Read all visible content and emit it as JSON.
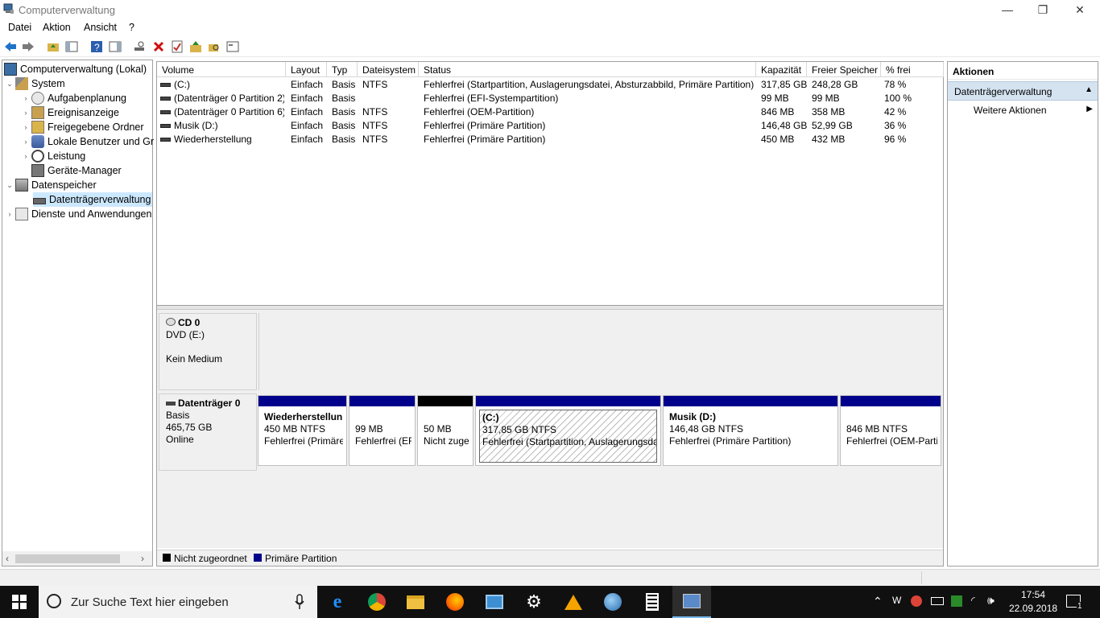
{
  "window": {
    "title": "Computerverwaltung",
    "min": "—",
    "max": "❐",
    "close": "✕"
  },
  "menu": [
    "Datei",
    "Aktion",
    "Ansicht",
    "?"
  ],
  "tree": {
    "root": "Computerverwaltung (Lokal)",
    "system": "System",
    "aufgabenplanung": "Aufgabenplanung",
    "ereignisanzeige": "Ereignisanzeige",
    "freigegebene": "Freigegebene Ordner",
    "lokale": "Lokale Benutzer und Gr",
    "leistung": "Leistung",
    "geraete": "Geräte-Manager",
    "datenspeicher": "Datenspeicher",
    "datentraeger": "Datenträgerverwaltung",
    "dienste": "Dienste und Anwendungen"
  },
  "volumes": {
    "headers": [
      "Volume",
      "Layout",
      "Typ",
      "Dateisystem",
      "Status",
      "Kapazität",
      "Freier Speicher",
      "% frei"
    ],
    "rows": [
      [
        "(C:)",
        "Einfach",
        "Basis",
        "NTFS",
        "Fehlerfrei (Startpartition, Auslagerungsdatei, Absturzabbild, Primäre Partition)",
        "317,85 GB",
        "248,28 GB",
        "78 %"
      ],
      [
        "(Datenträger 0 Partition 2)",
        "Einfach",
        "Basis",
        "",
        "Fehlerfrei (EFI-Systempartition)",
        "99 MB",
        "99 MB",
        "100 %"
      ],
      [
        "(Datenträger 0 Partition 6)",
        "Einfach",
        "Basis",
        "NTFS",
        "Fehlerfrei (OEM-Partition)",
        "846 MB",
        "358 MB",
        "42 %"
      ],
      [
        "Musik (D:)",
        "Einfach",
        "Basis",
        "NTFS",
        "Fehlerfrei (Primäre Partition)",
        "146,48 GB",
        "52,99 GB",
        "36 %"
      ],
      [
        "Wiederherstellung",
        "Einfach",
        "Basis",
        "NTFS",
        "Fehlerfrei (Primäre Partition)",
        "450 MB",
        "432 MB",
        "96 %"
      ]
    ]
  },
  "cd0": {
    "name": "CD 0",
    "type": "DVD (E:)",
    "status": "Kein Medium"
  },
  "disk0": {
    "name": "Datenträger 0",
    "type": "Basis",
    "size": "465,75 GB",
    "status": "Online",
    "partitions": [
      {
        "title": "Wiederherstellun",
        "size": "450 MB NTFS",
        "status": "Fehlerfrei (Primäre"
      },
      {
        "title": "",
        "size": "99 MB",
        "status": "Fehlerfrei (EF"
      },
      {
        "title": "",
        "size": "50 MB",
        "status": "Nicht zuge"
      },
      {
        "title": "(C:)",
        "size": "317,85 GB NTFS",
        "status": "Fehlerfrei (Startpartition, Auslagerungsdat"
      },
      {
        "title": "Musik  (D:)",
        "size": "146,48 GB NTFS",
        "status": "Fehlerfrei (Primäre Partition)"
      },
      {
        "title": "",
        "size": "846 MB NTFS",
        "status": "Fehlerfrei (OEM-Parti"
      }
    ]
  },
  "legend": {
    "unallocated": "Nicht zugeordnet",
    "primary": "Primäre Partition"
  },
  "colors": {
    "primary": "#00008b",
    "unallocated": "#000000",
    "selection": "#cce8ff"
  },
  "actions": {
    "title": "Aktionen",
    "section": "Datenträgerverwaltung",
    "more": "Weitere Aktionen"
  },
  "taskbar": {
    "search_placeholder": "Zur Suche Text hier eingeben",
    "time": "17:54",
    "date": "22.09.2018",
    "notifications": "1"
  }
}
